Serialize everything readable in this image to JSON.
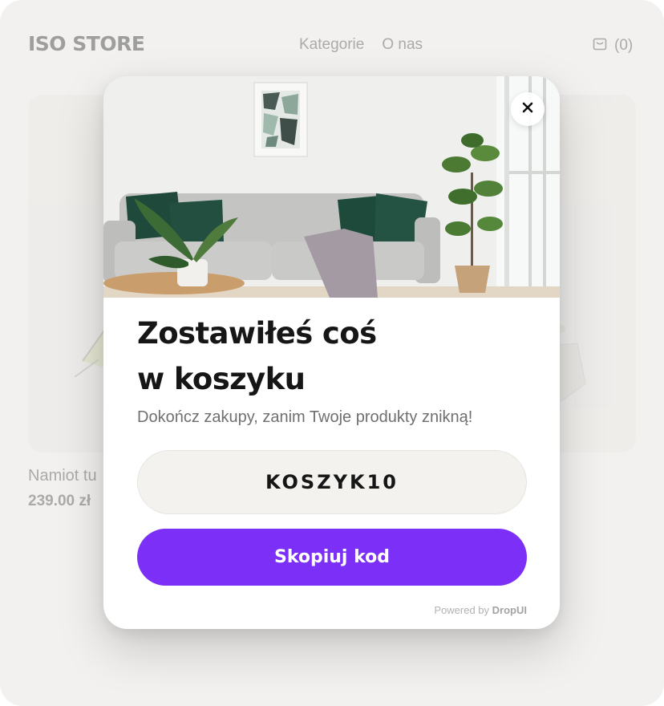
{
  "store": {
    "logo": "ISO STORE",
    "nav": [
      "Kategorie",
      "O nas"
    ],
    "cart_count": "(0)",
    "product": {
      "name": "Namiot tu",
      "price": "239.00 zł"
    }
  },
  "modal": {
    "title_line1": "Zostawiłeś coś",
    "title_line2": "w koszyku",
    "subtitle": "Dokończ zakupy, zanim Twoje produkty znikną!",
    "code": "KOSZYK10",
    "copy_button": "Skopiuj kod",
    "powered_prefix": "Powered by",
    "powered_brand": "DropUI",
    "accent_color": "#7b2ff7"
  },
  "icons": {
    "cart": "shopping-bag-icon",
    "close": "close-icon"
  }
}
